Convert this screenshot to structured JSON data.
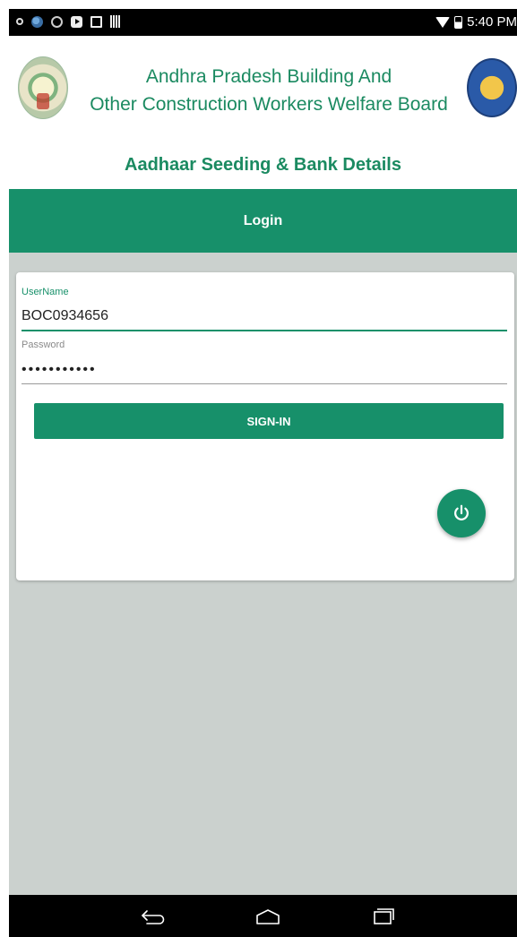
{
  "status_bar": {
    "time": "5:40 PM"
  },
  "header": {
    "org_title_line1": "Andhra Pradesh Building And",
    "org_title_line2": "Other Construction Workers Welfare Board",
    "app_subtitle": "Aadhaar Seeding & Bank Details"
  },
  "login": {
    "title": "Login",
    "username_label": "UserName",
    "username_value": "BOC0934656",
    "password_label": "Password",
    "password_value": "•••••••••••",
    "signin_label": "SIGN-IN"
  },
  "icons": {
    "fab": "power-icon",
    "nav": [
      "back-icon",
      "home-icon",
      "recents-icon"
    ]
  },
  "colors": {
    "accent": "#17906a",
    "title_green": "#1b8a61",
    "background_gray": "#cbd1ce"
  }
}
